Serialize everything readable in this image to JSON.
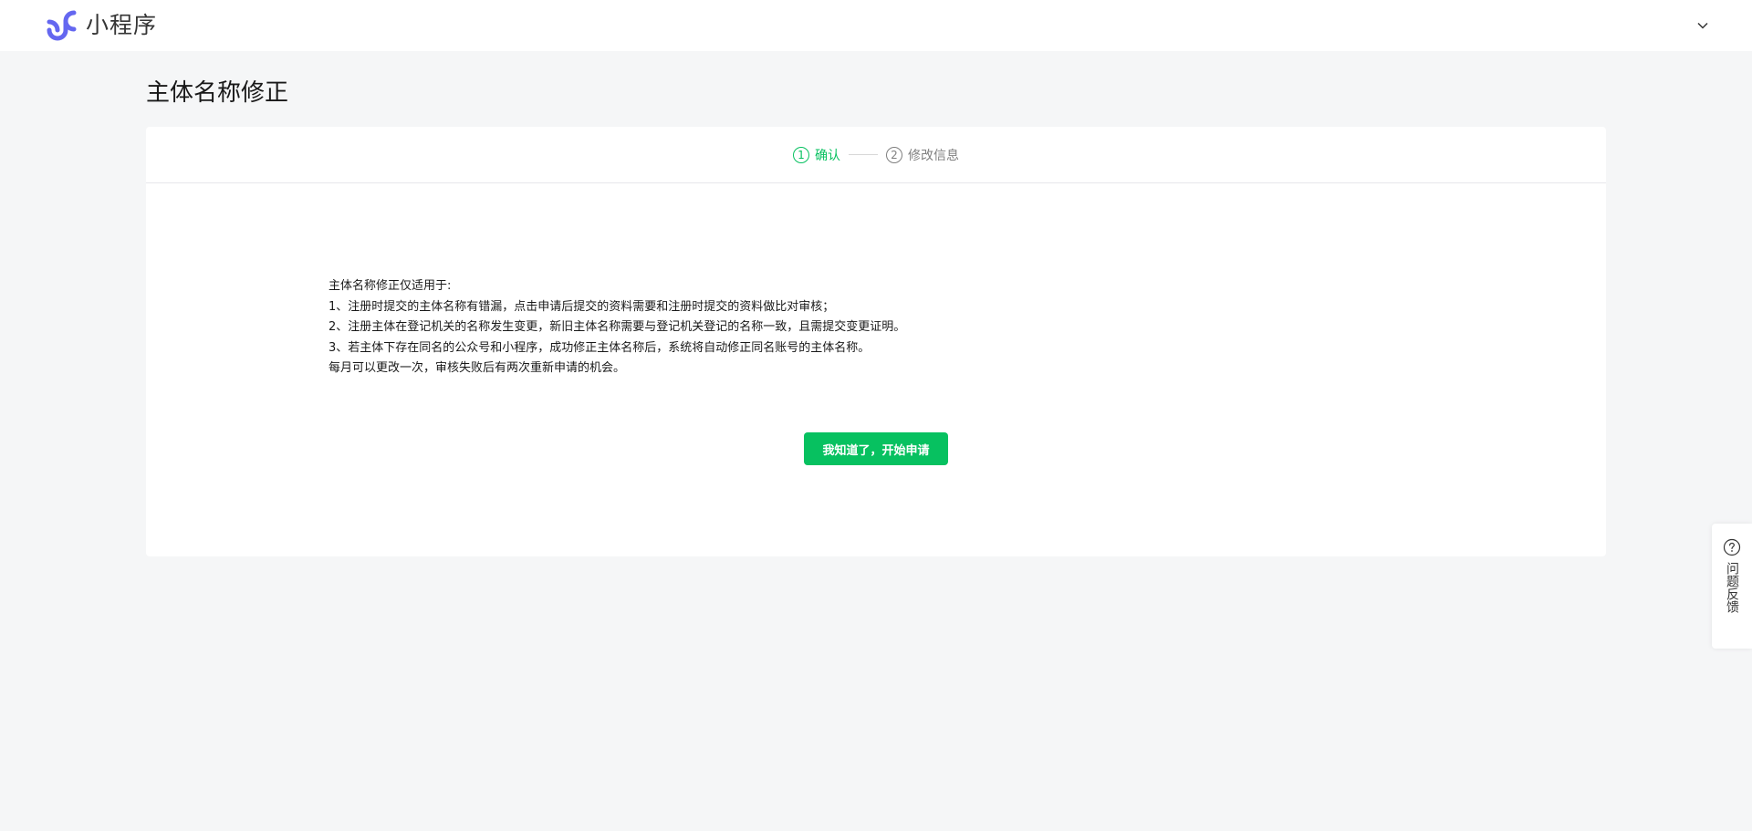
{
  "header": {
    "app_name": "小程序",
    "logo_icon": "mini-program-logo-icon",
    "account_icon": "chevron-down-icon"
  },
  "page": {
    "title": "主体名称修正"
  },
  "steps": [
    {
      "number": "1",
      "label": "确认",
      "state": "active"
    },
    {
      "number": "2",
      "label": "修改信息",
      "state": "inactive"
    }
  ],
  "notice": {
    "lines": [
      "主体名称修正仅适用于:",
      "1、注册时提交的主体名称有错漏，点击申请后提交的资料需要和注册时提交的资料做比对审核；",
      "2、注册主体在登记机关的名称发生变更，新旧主体名称需要与登记机关登记的名称一致，且需提交变更证明。",
      "3、若主体下存在同名的公众号和小程序，成功修正主体名称后，系统将自动修正同名账号的主体名称。",
      "每月可以更改一次，审核失败后有两次重新申请的机会。"
    ]
  },
  "actions": {
    "start_label": "我知道了，开始申请"
  },
  "feedback": {
    "label": "问题反馈",
    "icon": "question-circle-icon"
  },
  "colors": {
    "accent": "#07c160",
    "brand_logo": "#6467f0",
    "background": "#f5f6f7"
  }
}
